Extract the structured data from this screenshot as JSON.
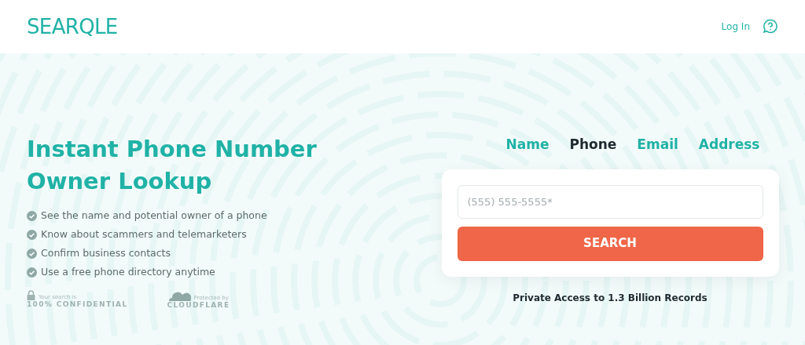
{
  "header": {
    "logo": "SEARQLE",
    "login": "Log In"
  },
  "hero": {
    "title": "Instant Phone Number Owner Lookup",
    "features": [
      "See the name and potential owner of a phone",
      "Know about scammers and telemarketers",
      "Confirm business contacts",
      "Use a free phone directory anytime"
    ],
    "badges": [
      {
        "kind": "lock",
        "small": "Your search is",
        "big": "100% CONFIDENTIAL"
      },
      {
        "kind": "cloud",
        "small": "Protected by",
        "big": "CLOUDFLARE"
      }
    ]
  },
  "tabs": [
    {
      "label": "Name",
      "selected": false
    },
    {
      "label": "Phone",
      "selected": true
    },
    {
      "label": "Email",
      "selected": false
    },
    {
      "label": "Address",
      "selected": false
    }
  ],
  "search": {
    "placeholder": "(555) 555-5555*",
    "button": "SEARCH"
  },
  "note": "Private Access to 1.3 Billion Records"
}
